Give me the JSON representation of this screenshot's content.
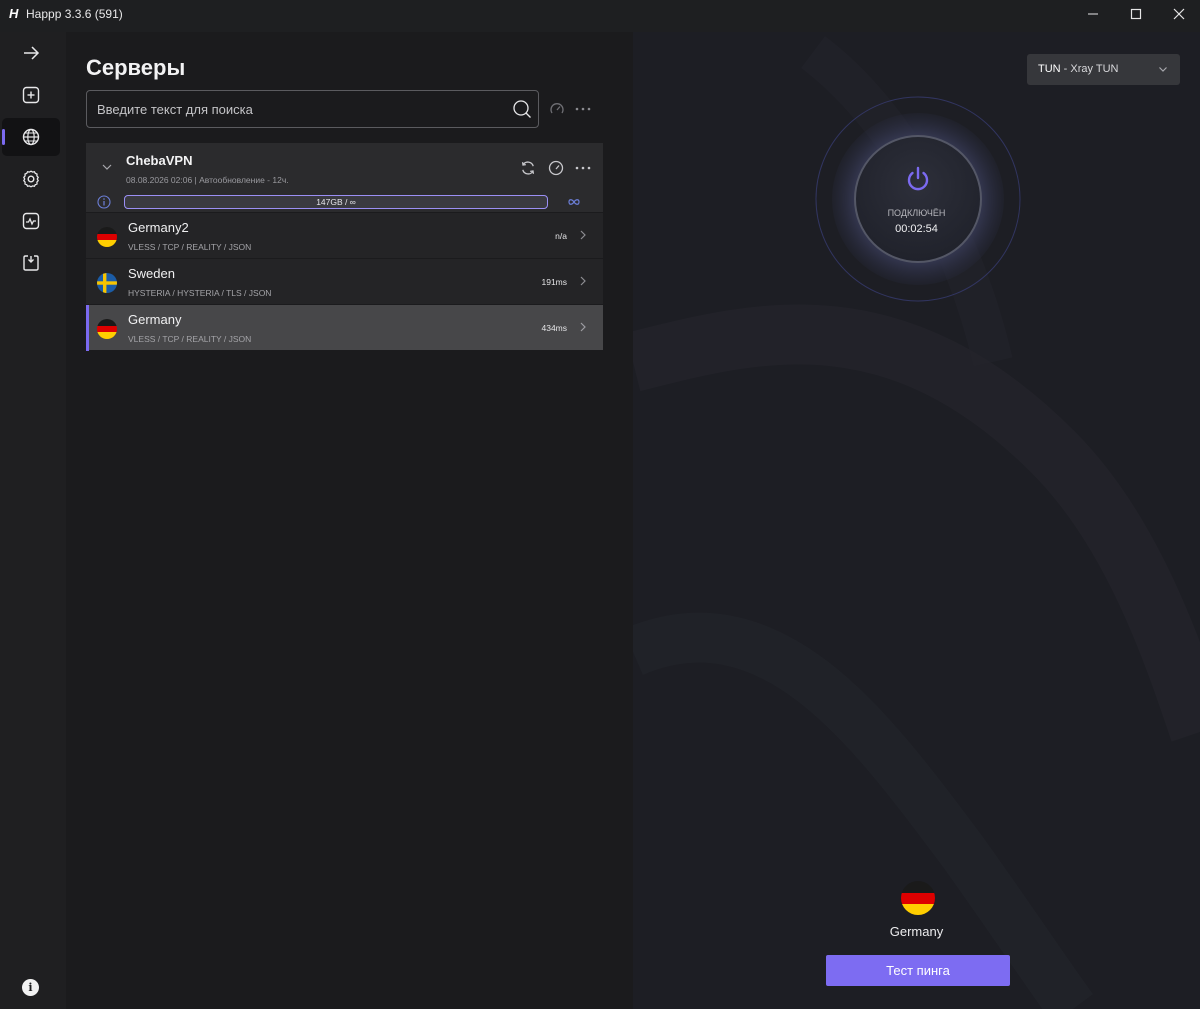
{
  "window": {
    "logo": "H",
    "title": "Happp 3.3.6 (591)"
  },
  "colors": {
    "accent": "#7b6af0",
    "button": "#7d6cf2",
    "background": "#1b1b1d"
  },
  "sidebar": {
    "items": [
      {
        "icon": "arrow-right-icon"
      },
      {
        "icon": "add-icon"
      },
      {
        "icon": "globe-icon",
        "active": true
      },
      {
        "icon": "gear-icon"
      },
      {
        "icon": "activity-icon"
      },
      {
        "icon": "import-icon"
      }
    ],
    "bottom_icon": "info-icon",
    "bottom_label": "i"
  },
  "servers": {
    "title": "Серверы",
    "search_placeholder": "Введите текст для поиска",
    "group": {
      "name": "ChebaVPN",
      "meta": "08.08.2026 02:06 | Автообновление - 12ч.",
      "traffic": "147GB / ∞",
      "rows": [
        {
          "name": "Germany2",
          "protocol": "VLESS / TCP / REALITY / JSON",
          "ping": "n/a",
          "flag": "de"
        },
        {
          "name": "Sweden",
          "protocol": "HYSTERIA / HYSTERIA / TLS / JSON",
          "ping": "191ms",
          "flag": "se"
        },
        {
          "name": "Germany",
          "protocol": "VLESS / TCP / REALITY / JSON",
          "ping": "434ms",
          "flag": "de",
          "selected": true
        }
      ]
    }
  },
  "connection": {
    "mode_label": "TUN",
    "mode_sep": " - ",
    "mode_value": "Xray TUN",
    "status": "ПОДКЛЮЧЁН",
    "timer": "00:02:54",
    "server_name": "Germany",
    "server_flag": "de",
    "ping_button": "Тест пинга"
  }
}
